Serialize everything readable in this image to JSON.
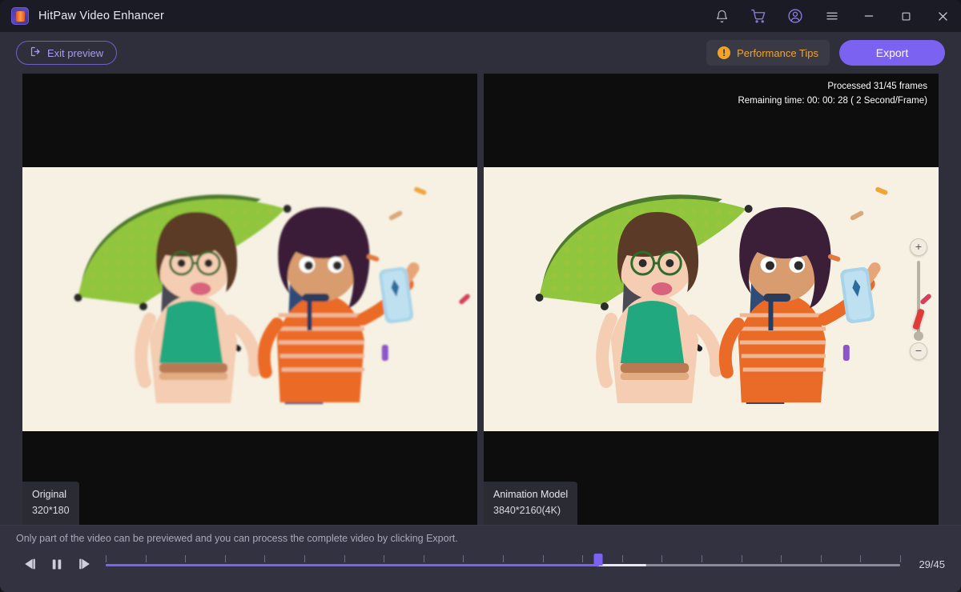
{
  "window": {
    "title": "HitPaw Video Enhancer",
    "logo_icon": "hitpaw-logo-icon",
    "controls": [
      {
        "name": "notification-bell-icon",
        "glyph": "bell"
      },
      {
        "name": "shopping-cart-icon",
        "glyph": "cart"
      },
      {
        "name": "account-icon",
        "glyph": "account"
      },
      {
        "name": "menu-icon",
        "glyph": "hamburger"
      },
      {
        "name": "minimize-icon",
        "glyph": "minimize"
      },
      {
        "name": "maximize-icon",
        "glyph": "maximize"
      },
      {
        "name": "close-icon",
        "glyph": "close"
      }
    ]
  },
  "toolbar": {
    "exit_preview_label": "Exit preview",
    "performance_tips_label": "Performance Tips",
    "performance_tips_badge": "!",
    "export_label": "Export"
  },
  "preview": {
    "status_line_1": "Processed 31/45 frames",
    "status_line_2": "Remaining time: 00: 00: 28 ( 2 Second/Frame)",
    "left_badge": {
      "title": "Original",
      "resolution": "320*180"
    },
    "right_badge": {
      "title": "Animation Model",
      "resolution": "3840*2160(4K)"
    },
    "zoom_in_label": "+",
    "zoom_out_label": "−"
  },
  "bottom": {
    "hint": "Only part of the video can be previewed and you can process the complete video by clicking Export.",
    "prev_frame_label": "previous-frame",
    "pause_label": "pause",
    "next_frame_label": "next-frame",
    "frame_counter": "29/45",
    "progress_percent": 62,
    "buffer_percent": 68,
    "tick_count": 21
  },
  "colors": {
    "accent": "#7b62f0",
    "warning": "#f0a42a",
    "window_bg": "#2f2f3b",
    "titlebar_bg": "#1b1b25",
    "pane_bg": "#0d0d0d",
    "video_bg": "#f6f1e3"
  }
}
